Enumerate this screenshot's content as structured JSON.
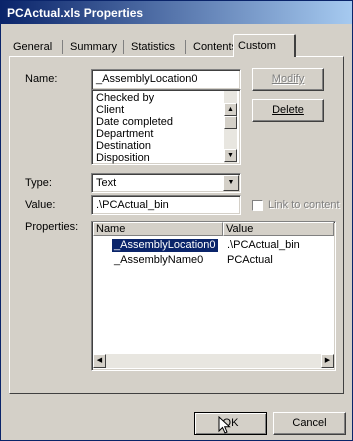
{
  "window": {
    "title": "PCActual.xls Properties"
  },
  "tabs": [
    {
      "label": "General"
    },
    {
      "label": "Summary"
    },
    {
      "label": "Statistics"
    },
    {
      "label": "Contents"
    },
    {
      "label": "Custom"
    }
  ],
  "custom": {
    "name_label": "Name:",
    "name_value": "_AssemblyLocation0",
    "name_options": [
      "Checked by",
      "Client",
      "Date completed",
      "Department",
      "Destination",
      "Disposition"
    ],
    "modify_label": "Modify",
    "delete_label": "Delete",
    "type_label": "Type:",
    "type_value": "Text",
    "value_label": "Value:",
    "value_value": ".\\PCActual_bin",
    "link_label": "Link to content",
    "properties_label": "Properties:",
    "columns": [
      "Name",
      "Value"
    ],
    "rows": [
      {
        "name": "_AssemblyLocation0",
        "value": ".\\PCActual_bin"
      },
      {
        "name": "_AssemblyName0",
        "value": "PCActual"
      }
    ]
  },
  "footer": {
    "ok_label": "OK",
    "cancel_label": "Cancel"
  }
}
